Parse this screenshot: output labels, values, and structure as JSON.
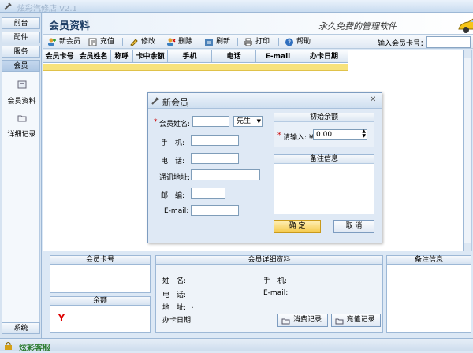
{
  "window": {
    "title": "炫彩汽修店 V2.1"
  },
  "nav": {
    "tabs": [
      {
        "label": "前台"
      },
      {
        "label": "配件"
      },
      {
        "label": "服务"
      },
      {
        "label": "会员"
      }
    ],
    "items": [
      {
        "label": "会员资料",
        "icon": "member-card-icon"
      },
      {
        "label": "详细记录",
        "icon": "folder-icon"
      }
    ],
    "bottom_tab": "系统"
  },
  "header": {
    "title": "会员资料",
    "slogan": "永久免费的管理软件"
  },
  "toolbar": {
    "new_member": "新会员",
    "recharge": "充值",
    "edit": "修改",
    "delete": "删除",
    "refresh": "刷新",
    "print": "打印",
    "help": "帮助",
    "card_label": "输入会员卡号：",
    "card_value": ""
  },
  "grid": {
    "columns": [
      "会员卡号",
      "会员姓名",
      "称呼",
      "卡中余额",
      "手机",
      "电话",
      "E-mail",
      "办卡日期"
    ]
  },
  "dialog": {
    "title": "新会员",
    "name_label": "会员姓名:",
    "name_value": "",
    "salutation": "先生",
    "mobile_label": "手　机:",
    "phone_label": "电　话:",
    "address_label": "通讯地址:",
    "zip_label": "邮　编:",
    "email_label": "E-mail:",
    "balance_group": "初始余额",
    "balance_label": "请输入: ¥",
    "balance_value": "0.00",
    "note_group": "备注信息",
    "ok": "确 定",
    "cancel": "取 消"
  },
  "bottom": {
    "card_panel": "会员卡号",
    "balance_panel": "余额",
    "balance_symbol": "Y",
    "detail_panel": "会员详细资料",
    "note_panel": "备注信息",
    "name_label": "姓　名:",
    "mobile_label": "手　机:",
    "phone_label": "电　话:",
    "email_label": "E-mail:",
    "address_label": "地　址:",
    "address_value": ",",
    "date_label": "办卡日期:",
    "consume_btn": "消费记录",
    "recharge_btn": "充值记录"
  },
  "status": {
    "text": "炫彩客服"
  },
  "colors": {
    "accent": "#f5c94a",
    "highlight_row": "#f7e27c",
    "frame": "#9db8d6"
  }
}
